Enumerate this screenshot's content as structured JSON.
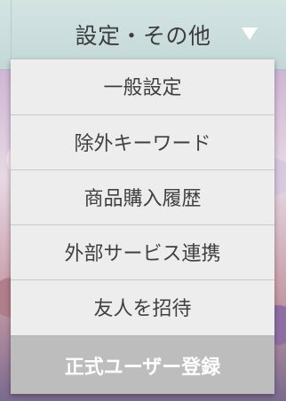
{
  "header": {
    "label": "設定・その他",
    "caret_icon": "triangle-down-icon"
  },
  "menu": {
    "items": [
      {
        "label": "一般設定"
      },
      {
        "label": "除外キーワード"
      },
      {
        "label": "商品購入履歴"
      },
      {
        "label": "外部サービス連携"
      },
      {
        "label": "友人を招待"
      },
      {
        "label": "正式ユーザー登録"
      }
    ]
  },
  "colors": {
    "header_bg": "#c9dddc",
    "menu_bg": "#ededed",
    "active_item_bg": "#bdbdbd",
    "accent_strip": "#b44ad3"
  }
}
